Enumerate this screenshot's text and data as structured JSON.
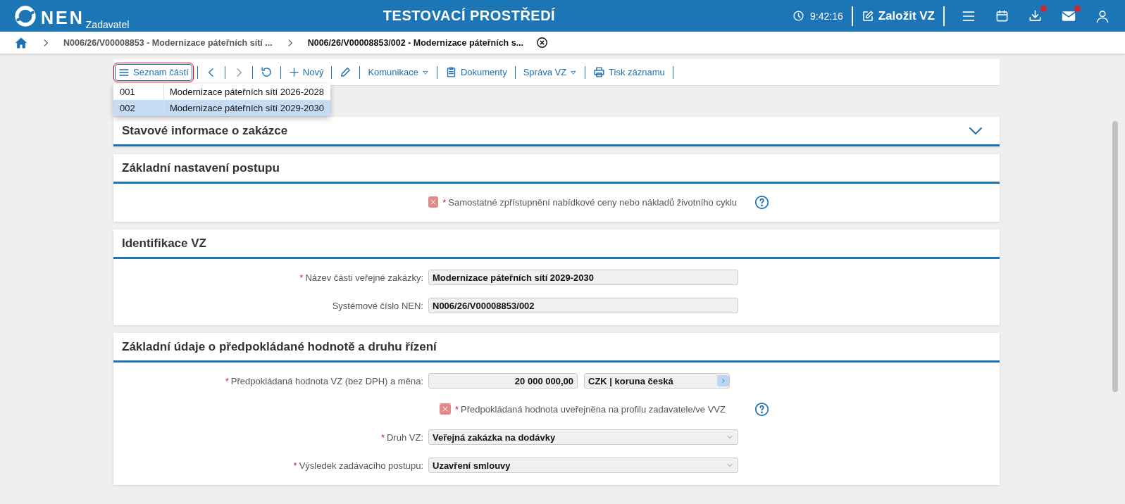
{
  "header": {
    "logo_text": "NEN",
    "logo_sub": "Zadavatel",
    "env_title": "TESTOVACÍ PROSTŘEDÍ",
    "time": "9:42:16",
    "create_button": "Založit VZ",
    "download_badge": true,
    "mail_badge": true
  },
  "breadcrumb": {
    "items": [
      {
        "label": "N006/26/V00008853 - Modernizace páteřních sítí ...",
        "current": false
      },
      {
        "label": "N006/26/V00008853/002 - Modernizace páteřních s...",
        "current": true
      }
    ]
  },
  "toolbar": {
    "parts_button": "Seznam částí",
    "parts_open": true,
    "new_button": "Nový",
    "communication": "Komunikace",
    "documents": "Dokumenty",
    "management": "Správa VZ",
    "print": "Tisk záznamu"
  },
  "parts": [
    {
      "code": "001",
      "name": "Modernizace páteřních sítí 2026-2028",
      "selected": false
    },
    {
      "code": "002",
      "name": "Modernizace páteřních sítí 2029-2030",
      "selected": true
    }
  ],
  "sections": [
    {
      "title": "Stavové informace o zakázce",
      "expanded": false
    },
    {
      "title": "Základní nastavení postupu",
      "expanded": true,
      "rows": [
        {
          "kind": "checkbox",
          "marker": "*",
          "label": "Samostatné zpřístupnění nabídkové ceny nebo nákladů životního cyklu",
          "rejected": true,
          "help": true
        }
      ]
    },
    {
      "title": "Identifikace VZ",
      "expanded": true,
      "rows": [
        {
          "kind": "text",
          "marker": "*",
          "label": "Název části veřejné zakázky:",
          "value": "Modernizace páteřních sítí 2029-2030"
        },
        {
          "kind": "text",
          "label": "Systémové číslo NEN:",
          "value": "N006/26/V00008853/002"
        }
      ]
    },
    {
      "title": "Základní údaje o předpokládané hodnotě a druhu řízení",
      "expanded": true,
      "rows": [
        {
          "kind": "money",
          "marker": "*",
          "label": "Předpokládaná hodnota VZ (bez DPH) a měna:",
          "amount": "20 000 000,00",
          "currency_code": "CZK",
          "currency_separator": "|",
          "currency_name": "koruna česká"
        },
        {
          "kind": "checkbox",
          "marker": "*",
          "label": "Předpokládaná hodnota uveřejněna na profilu zadavatele/ve VVZ",
          "rejected": true,
          "help": true
        },
        {
          "kind": "select",
          "marker": "*",
          "label": "Druh VZ:",
          "value": "Veřejná zakázka na dodávky"
        },
        {
          "kind": "select",
          "marker": "*",
          "label": "Výsledek zadávacího postupu:",
          "value": "Uzavření smlouvy"
        }
      ]
    }
  ]
}
